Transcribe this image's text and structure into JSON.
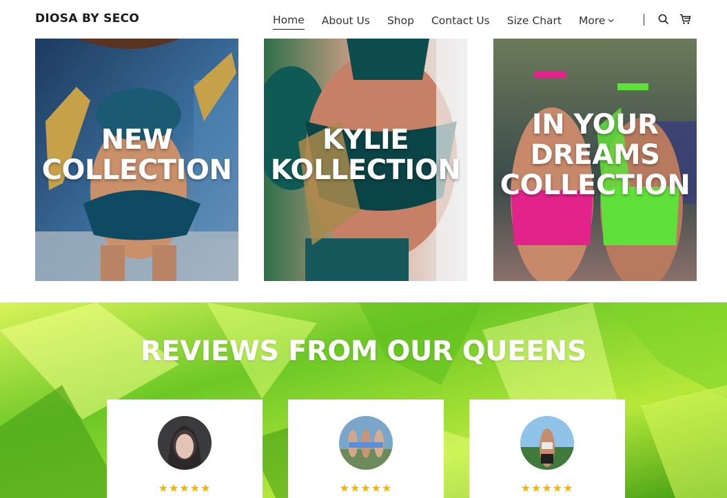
{
  "header": {
    "brand": "DIOSA BY SECO",
    "nav": [
      {
        "label": "Home",
        "active": true
      },
      {
        "label": "About Us"
      },
      {
        "label": "Shop"
      },
      {
        "label": "Contact Us"
      },
      {
        "label": "Size Chart"
      }
    ],
    "more_label": "More",
    "icons": [
      "search-icon",
      "cart-icon"
    ]
  },
  "collections": [
    {
      "label": "NEW COLLECTION",
      "lines": [
        "NEW",
        "COLLECTION"
      ]
    },
    {
      "label": "KYLIE KOLLECTION",
      "lines": [
        "KYLIE",
        "KOLLECTION"
      ]
    },
    {
      "label": "IN YOUR DREAMS COLLECTION",
      "lines": [
        "IN YOUR",
        "DREAMS",
        "COLLECTION"
      ]
    }
  ],
  "reviews": {
    "title": "REVIEWS FROM OUR QUEENS",
    "cards": [
      {
        "stars": "★★★★★"
      },
      {
        "stars": "★★★★★"
      },
      {
        "stars": "★★★★★"
      }
    ]
  },
  "colors": {
    "brand_text": "#1b1b1b",
    "star": "#f5b400",
    "review_bg": "#7ed321"
  }
}
